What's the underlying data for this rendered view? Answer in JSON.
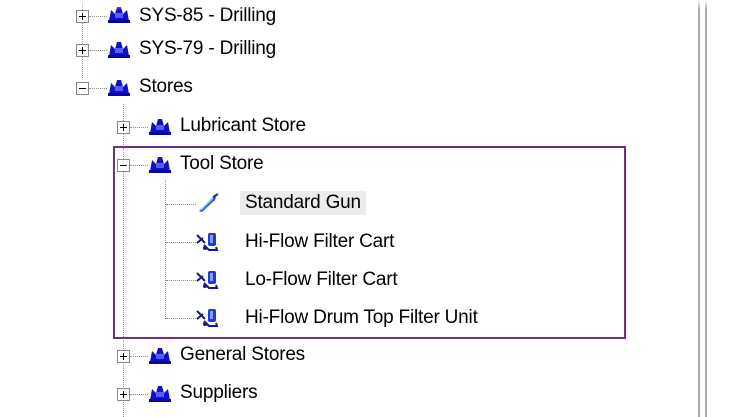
{
  "tree": {
    "nodes": [
      {
        "label": "SYS-85 - Drilling",
        "level": 1,
        "state": "collapsed",
        "icon": "system-icon"
      },
      {
        "label": "SYS-79 - Drilling",
        "level": 1,
        "state": "collapsed",
        "icon": "system-icon"
      },
      {
        "label": "Stores",
        "level": 1,
        "state": "expanded",
        "icon": "system-icon"
      },
      {
        "label": "Lubricant Store",
        "level": 2,
        "state": "collapsed",
        "icon": "system-icon"
      },
      {
        "label": "Tool Store",
        "level": 2,
        "state": "expanded",
        "icon": "system-icon"
      },
      {
        "label": "Standard Gun",
        "level": 3,
        "state": "leaf",
        "icon": "grease-gun-icon",
        "selected": true
      },
      {
        "label": "Hi-Flow Filter Cart",
        "level": 3,
        "state": "leaf",
        "icon": "filter-cart-icon"
      },
      {
        "label": "Lo-Flow Filter Cart",
        "level": 3,
        "state": "leaf",
        "icon": "filter-cart-icon"
      },
      {
        "label": "Hi-Flow Drum Top Filter Unit",
        "level": 3,
        "state": "leaf",
        "icon": "filter-cart-icon"
      },
      {
        "label": "General Stores",
        "level": 2,
        "state": "collapsed",
        "icon": "system-icon"
      },
      {
        "label": "Suppliers",
        "level": 2,
        "state": "collapsed",
        "icon": "system-icon"
      }
    ]
  },
  "colors": {
    "system_icon": "#1010c8",
    "gun_icon": "#2a5fd0",
    "highlight_border": "#7b2a84",
    "selection_bg": "#ececec"
  }
}
